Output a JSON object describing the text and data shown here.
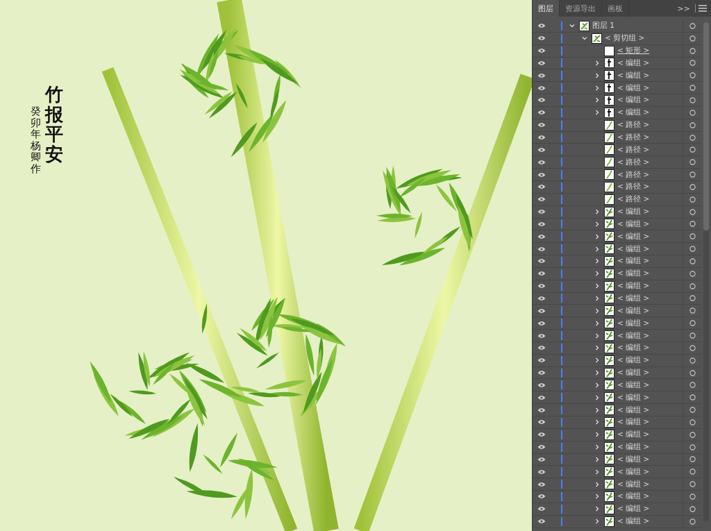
{
  "canvas": {
    "title_text": "竹报平安",
    "signature": "癸卯年杨卿作"
  },
  "layers_panel": {
    "tabs": [
      {
        "label": "图层",
        "selected": true
      },
      {
        "label": "资源导出",
        "selected": false
      },
      {
        "label": "画板",
        "selected": false
      }
    ],
    "overflow": ">>",
    "layers": [
      {
        "label": "图层 1",
        "kind": "art",
        "visible": true,
        "selected": false,
        "expanded": true,
        "children": [
          {
            "label": "< 剪切组 >",
            "kind": "art",
            "visible": true,
            "selected": false,
            "expanded": true,
            "children": [
              {
                "label": "< 矩形 >",
                "kind": "blank",
                "visible": true,
                "selected": true
              },
              {
                "label": "< 编组 >",
                "kind": "ink",
                "visible": true,
                "selected": false,
                "expanded": false
              },
              {
                "label": "< 编组 >",
                "kind": "ink",
                "visible": true,
                "selected": false,
                "expanded": false
              },
              {
                "label": "< 编组 >",
                "kind": "ink",
                "visible": true,
                "selected": false,
                "expanded": false
              },
              {
                "label": "< 编组 >",
                "kind": "ink",
                "visible": true,
                "selected": false,
                "expanded": false
              },
              {
                "label": "< 编组 >",
                "kind": "ink",
                "visible": true,
                "selected": false,
                "expanded": false
              },
              {
                "label": "< 路径 >",
                "kind": "leaf",
                "visible": true,
                "selected": false
              },
              {
                "label": "< 路径 >",
                "kind": "leaf",
                "visible": true,
                "selected": false
              },
              {
                "label": "< 路径 >",
                "kind": "leaf",
                "visible": true,
                "selected": false
              },
              {
                "label": "< 路径 >",
                "kind": "leaf",
                "visible": true,
                "selected": false
              },
              {
                "label": "< 路径 >",
                "kind": "leaf",
                "visible": true,
                "selected": false
              },
              {
                "label": "< 路径 >",
                "kind": "leaf",
                "visible": true,
                "selected": false
              },
              {
                "label": "< 路径 >",
                "kind": "leaf",
                "visible": true,
                "selected": false
              },
              {
                "label": "< 编组 >",
                "kind": "bamboo",
                "visible": true,
                "selected": false,
                "expanded": false
              },
              {
                "label": "< 编组 >",
                "kind": "bamboo",
                "visible": true,
                "selected": false,
                "expanded": false
              },
              {
                "label": "< 编组 >",
                "kind": "bamboo",
                "visible": true,
                "selected": false,
                "expanded": false
              },
              {
                "label": "< 编组 >",
                "kind": "bamboo",
                "visible": true,
                "selected": false,
                "expanded": false
              },
              {
                "label": "< 编组 >",
                "kind": "bamboo",
                "visible": true,
                "selected": false,
                "expanded": false
              },
              {
                "label": "< 编组 >",
                "kind": "bamboo",
                "visible": true,
                "selected": false,
                "expanded": false
              },
              {
                "label": "< 编组 >",
                "kind": "bamboo",
                "visible": true,
                "selected": false,
                "expanded": false
              },
              {
                "label": "< 编组 >",
                "kind": "bamboo",
                "visible": true,
                "selected": false,
                "expanded": false
              },
              {
                "label": "< 编组 >",
                "kind": "bamboo",
                "visible": true,
                "selected": false,
                "expanded": false
              },
              {
                "label": "< 编组 >",
                "kind": "bamboo",
                "visible": true,
                "selected": false,
                "expanded": false
              },
              {
                "label": "< 编组 >",
                "kind": "bamboo",
                "visible": true,
                "selected": false,
                "expanded": false
              },
              {
                "label": "< 编组 >",
                "kind": "bamboo",
                "visible": true,
                "selected": false,
                "expanded": false
              },
              {
                "label": "< 编组 >",
                "kind": "bamboo",
                "visible": true,
                "selected": false,
                "expanded": false
              },
              {
                "label": "< 编组 >",
                "kind": "bamboo",
                "visible": true,
                "selected": false,
                "expanded": false
              },
              {
                "label": "< 编组 >",
                "kind": "bamboo",
                "visible": true,
                "selected": false,
                "expanded": false
              },
              {
                "label": "< 编组 >",
                "kind": "bamboo",
                "visible": true,
                "selected": false,
                "expanded": false
              },
              {
                "label": "< 编组 >",
                "kind": "bamboo",
                "visible": true,
                "selected": false,
                "expanded": false
              },
              {
                "label": "< 编组 >",
                "kind": "bamboo",
                "visible": true,
                "selected": false,
                "expanded": false
              },
              {
                "label": "< 编组 >",
                "kind": "bamboo",
                "visible": true,
                "selected": false,
                "expanded": false
              },
              {
                "label": "< 编组 >",
                "kind": "bamboo",
                "visible": true,
                "selected": false,
                "expanded": false
              },
              {
                "label": "< 编组 >",
                "kind": "bamboo",
                "visible": true,
                "selected": false,
                "expanded": false
              },
              {
                "label": "< 编组 >",
                "kind": "bamboo",
                "visible": true,
                "selected": false,
                "expanded": false
              },
              {
                "label": "< 编组 >",
                "kind": "bamboo",
                "visible": true,
                "selected": false,
                "expanded": false
              },
              {
                "label": "< 编组 >",
                "kind": "bamboo",
                "visible": true,
                "selected": false,
                "expanded": false
              },
              {
                "label": "< 编组 >",
                "kind": "bamboo",
                "visible": true,
                "selected": false,
                "expanded": false
              },
              {
                "label": "< 编组 >",
                "kind": "bamboo",
                "visible": true,
                "selected": false,
                "expanded": false
              }
            ]
          }
        ]
      }
    ]
  }
}
